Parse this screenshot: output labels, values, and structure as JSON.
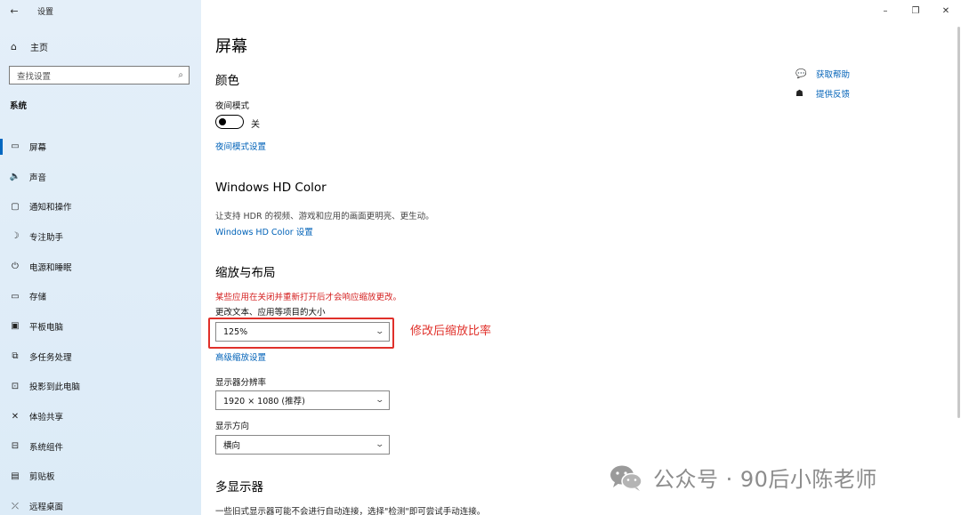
{
  "window": {
    "app_title": "设置",
    "controls": {
      "minimize": "–",
      "maximize": "❐",
      "close": "✕"
    }
  },
  "sidebar": {
    "home": "主页",
    "search_placeholder": "查找设置",
    "section": "系统",
    "items": [
      {
        "label": "屏幕",
        "icon": "display-icon",
        "glyph": "▭",
        "active": true
      },
      {
        "label": "声音",
        "icon": "speaker-icon",
        "glyph": "🔈"
      },
      {
        "label": "通知和操作",
        "icon": "notification-icon",
        "glyph": "▢"
      },
      {
        "label": "专注助手",
        "icon": "moon-icon",
        "glyph": "☽"
      },
      {
        "label": "电源和睡眠",
        "icon": "power-icon",
        "glyph": "⏻"
      },
      {
        "label": "存储",
        "icon": "storage-icon",
        "glyph": "▭"
      },
      {
        "label": "平板电脑",
        "icon": "tablet-icon",
        "glyph": "▣"
      },
      {
        "label": "多任务处理",
        "icon": "multitask-icon",
        "glyph": "⧉"
      },
      {
        "label": "投影到此电脑",
        "icon": "project-icon",
        "glyph": "⊡"
      },
      {
        "label": "体验共享",
        "icon": "share-icon",
        "glyph": "✕"
      },
      {
        "label": "系统组件",
        "icon": "components-icon",
        "glyph": "⊟"
      },
      {
        "label": "剪贴板",
        "icon": "clipboard-icon",
        "glyph": "▤"
      },
      {
        "label": "远程桌面",
        "icon": "remote-icon",
        "glyph": "⤫"
      }
    ]
  },
  "main": {
    "title": "屏幕",
    "color_section": "颜色",
    "night_mode_label": "夜间模式",
    "night_mode_state": "关",
    "night_mode_settings_link": "夜间模式设置",
    "hdr_section": "Windows HD Color",
    "hdr_desc": "让支持 HDR 的视频、游戏和应用的画面更明亮、更生动。",
    "hdr_link": "Windows HD Color 设置",
    "scale_section": "缩放与布局",
    "scale_warning": "某些应用在关闭并重新打开后才会响应缩放更改。",
    "scale_label": "更改文本、应用等项目的大小",
    "scale_value": "125%",
    "advanced_scale_link": "高级缩放设置",
    "resolution_label": "显示器分辨率",
    "resolution_value": "1920 × 1080 (推荐)",
    "orientation_label": "显示方向",
    "orientation_value": "横向",
    "multi_display_section": "多显示器",
    "multi_display_desc": "一些旧式显示器可能不会进行自动连接，选择\"检测\"即可尝试手动连接。"
  },
  "help": {
    "get_help": "获取帮助",
    "feedback": "提供反馈"
  },
  "annotation": {
    "text": "修改后缩放比率",
    "color": "#e0302a"
  },
  "watermark": {
    "text": "公众号 · 90后小陈老师"
  },
  "colors": {
    "accent": "#0062b8",
    "sidebar_bg": "#e3eef8",
    "warning": "#d42020"
  }
}
